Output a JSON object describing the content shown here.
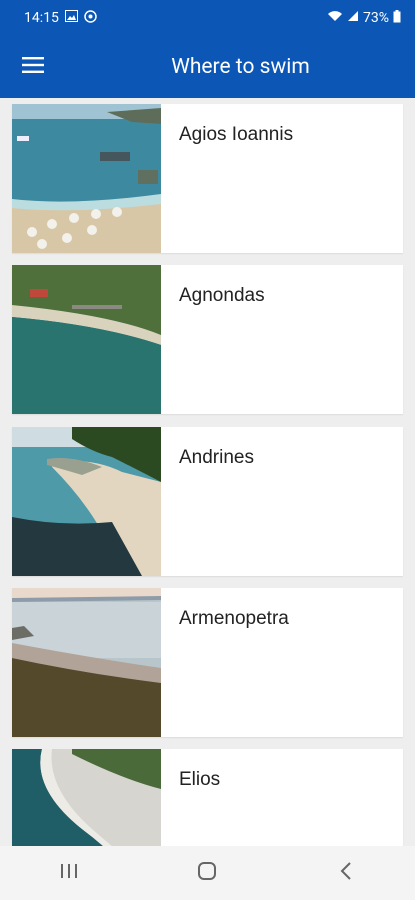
{
  "status_bar": {
    "time": "14:15",
    "battery": "73%",
    "icons": [
      "gallery-icon",
      "app-icon",
      "wifi-icon",
      "signal-icon",
      "battery-icon"
    ]
  },
  "app_bar": {
    "title": "Where to swim",
    "menu_icon": "hamburger-menu-icon"
  },
  "beaches": [
    {
      "name": "Agios Ioannis"
    },
    {
      "name": "Agnondas"
    },
    {
      "name": "Andrines"
    },
    {
      "name": "Armenopetra"
    },
    {
      "name": "Elios"
    }
  ],
  "nav_bar": {
    "icons": [
      "recent-apps-icon",
      "home-icon",
      "back-icon"
    ]
  },
  "colors": {
    "primary": "#0c56b6",
    "background": "#eeeeee",
    "card": "#ffffff"
  }
}
